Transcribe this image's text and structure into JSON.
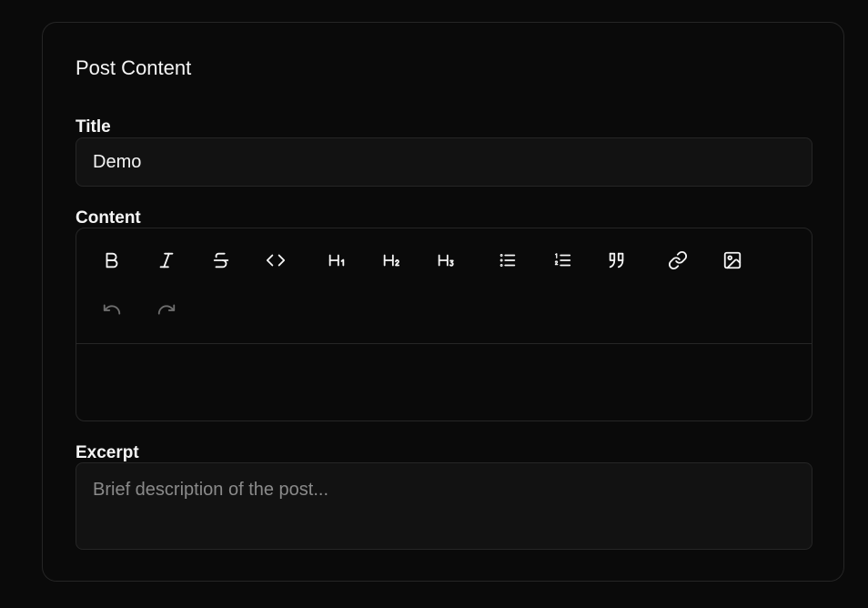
{
  "card": {
    "title": "Post Content"
  },
  "title_field": {
    "label": "Title",
    "value": "Demo"
  },
  "content_field": {
    "label": "Content",
    "toolbar": [
      {
        "name": "bold-icon",
        "icon": "bold"
      },
      {
        "name": "italic-icon",
        "icon": "italic"
      },
      {
        "name": "strikethrough-icon",
        "icon": "strike"
      },
      {
        "name": "code-icon",
        "icon": "code"
      },
      {
        "name": "heading-1-icon",
        "icon": "h1"
      },
      {
        "name": "heading-2-icon",
        "icon": "h2"
      },
      {
        "name": "heading-3-icon",
        "icon": "h3"
      },
      {
        "name": "bullet-list-icon",
        "icon": "ul"
      },
      {
        "name": "ordered-list-icon",
        "icon": "ol"
      },
      {
        "name": "quote-icon",
        "icon": "quote"
      },
      {
        "name": "link-icon",
        "icon": "link"
      },
      {
        "name": "image-icon",
        "icon": "image"
      },
      {
        "name": "undo-icon",
        "icon": "undo",
        "disabled": true
      },
      {
        "name": "redo-icon",
        "icon": "redo",
        "disabled": true
      }
    ],
    "body": ""
  },
  "excerpt_field": {
    "label": "Excerpt",
    "value": "",
    "placeholder": "Brief description of the post..."
  },
  "colors": {
    "background": "#0a0a0a",
    "border": "#262626",
    "input_background": "#121212",
    "text": "#f5f5f5",
    "placeholder": "#8a8a8a",
    "disabled_icon": "#6e6e6e"
  }
}
